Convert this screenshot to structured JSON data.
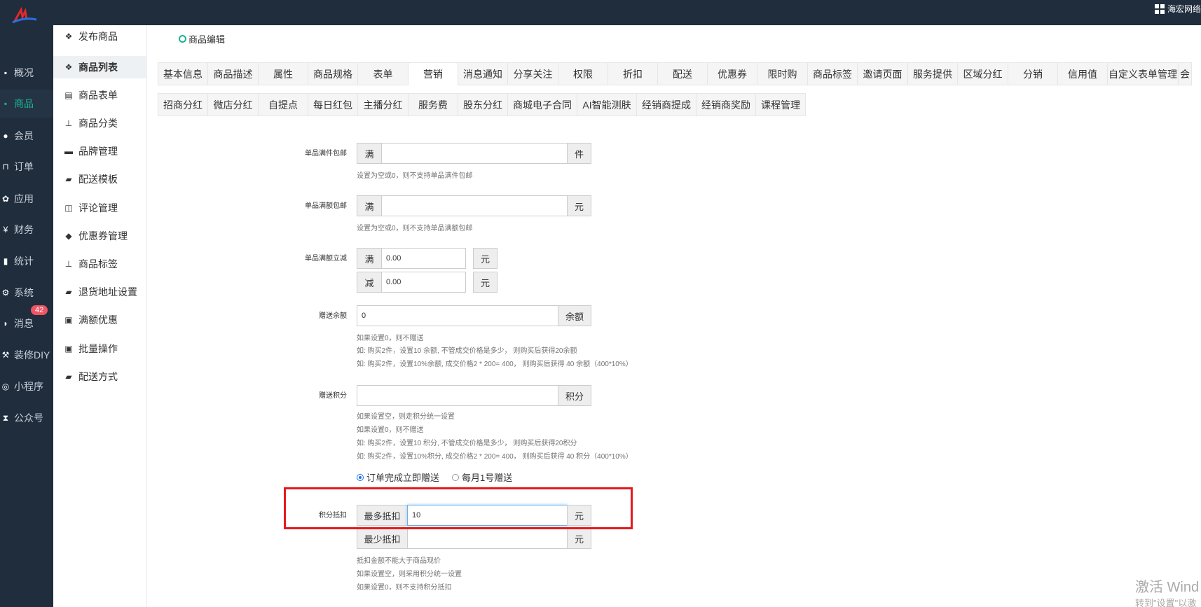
{
  "header": {
    "brand": "海宏网络"
  },
  "leftnav": [
    {
      "label": "概况",
      "icon": "dashboard-icon"
    },
    {
      "label": "商品",
      "icon": "goods-icon",
      "active": true
    },
    {
      "label": "会员",
      "icon": "users-icon"
    },
    {
      "label": "订单",
      "icon": "cart-icon"
    },
    {
      "label": "应用",
      "icon": "apps-icon"
    },
    {
      "label": "财务",
      "icon": "yen-icon"
    },
    {
      "label": "统计",
      "icon": "chart-icon"
    },
    {
      "label": "系统",
      "icon": "gears-icon"
    },
    {
      "label": "消息",
      "icon": "message-icon",
      "badge": "42"
    },
    {
      "label": "装修DIY",
      "icon": "hammer-icon"
    },
    {
      "label": "小程序",
      "icon": "wechat-icon"
    },
    {
      "label": "公众号",
      "icon": "hourglass-icon"
    }
  ],
  "subnav": [
    {
      "label": "发布商品",
      "icon": "cubes-icon"
    },
    {
      "label": "商品列表",
      "icon": "cubes-icon",
      "active": true
    },
    {
      "label": "商品表单",
      "icon": "file-icon"
    },
    {
      "label": "商品分类",
      "icon": "sitemap-icon"
    },
    {
      "label": "品牌管理",
      "icon": "briefcase-icon"
    },
    {
      "label": "配送模板",
      "icon": "truck-icon"
    },
    {
      "label": "评论管理",
      "icon": "columns-icon"
    },
    {
      "label": "优惠券管理",
      "icon": "tags-icon"
    },
    {
      "label": "商品标签",
      "icon": "sitemap-icon"
    },
    {
      "label": "退货地址设置",
      "icon": "truck-icon"
    },
    {
      "label": "满额优惠",
      "icon": "gift-icon"
    },
    {
      "label": "批量操作",
      "icon": "gift-icon"
    },
    {
      "label": "配送方式",
      "icon": "truck-icon"
    }
  ],
  "breadcrumb": "商品编辑",
  "tabs_row1": [
    "基本信息",
    "商品描述",
    "属性",
    "商品规格",
    "表单",
    "营销",
    "消息通知",
    "分享关注",
    "权限",
    "折扣",
    "配送",
    "优惠券",
    "限时购",
    "商品标签",
    "邀请页面",
    "服务提供",
    "区域分红",
    "分销",
    "信用值",
    "自定义表单管理",
    "会"
  ],
  "tabs_row1_active": 5,
  "tabs_row2": [
    "招商分红",
    "微店分红",
    "自提点",
    "每日红包",
    "主播分红",
    "服务费",
    "股东分红",
    "商城电子合同",
    "AI智能测肤",
    "经销商提成",
    "经销商奖励",
    "课程管理"
  ],
  "form": {
    "single_free_ship": {
      "label": "单品满件包邮",
      "prefix": "满",
      "value": "",
      "suffix": "件",
      "help": "设置为空或0，则不支持单品满件包邮"
    },
    "single_amount_ship": {
      "label": "单品满额包邮",
      "prefix": "满",
      "value": "",
      "suffix": "元",
      "help": "设置为空或0，则不支持单品满额包邮"
    },
    "single_reduce": {
      "label": "单品满额立减",
      "full_prefix": "满",
      "full_value": "0.00",
      "full_suffix": "元",
      "minus_prefix": "减",
      "minus_value": "0.00",
      "minus_suffix": "元"
    },
    "gift_balance": {
      "label": "赠送余额",
      "value": "0",
      "suffix": "余额",
      "help1": "如果设置0，则不赠送",
      "help2": "如: 购买2件，设置10 余额, 不管成交价格是多少， 则购买后获得20余额",
      "help3": "如: 购买2件，设置10%余额, 成交价格2 * 200= 400， 则购买后获得 40 余额（400*10%）"
    },
    "gift_points": {
      "label": "赠送积分",
      "value": "",
      "suffix": "积分",
      "help1": "如果设置空，则走积分统一设置",
      "help2": "如果设置0，则不赠送",
      "help3": "如: 购买2件，设置10 积分, 不管成交价格是多少， 则购买后获得20积分",
      "help4": "如: 购买2件，设置10%积分, 成交价格2 * 200= 400， 则购买后获得 40 积分（400*10%）"
    },
    "radio": {
      "opt1": "订单完成立即赠送",
      "opt2": "每月1号赠送",
      "selected": 1
    },
    "points_deduct": {
      "label": "积分抵扣",
      "max_prefix": "最多抵扣",
      "max_value": "10",
      "max_suffix": "元",
      "min_prefix": "最少抵扣",
      "min_value": "",
      "min_suffix": "元",
      "help1": "抵扣金额不能大于商品现价",
      "help2": "如果设置空，则采用积分统一设置",
      "help3": "如果设置0，则不支持积分抵扣"
    }
  },
  "watermark": {
    "line1": "激活 Wind",
    "line2": "转到\"设置\"以激"
  }
}
